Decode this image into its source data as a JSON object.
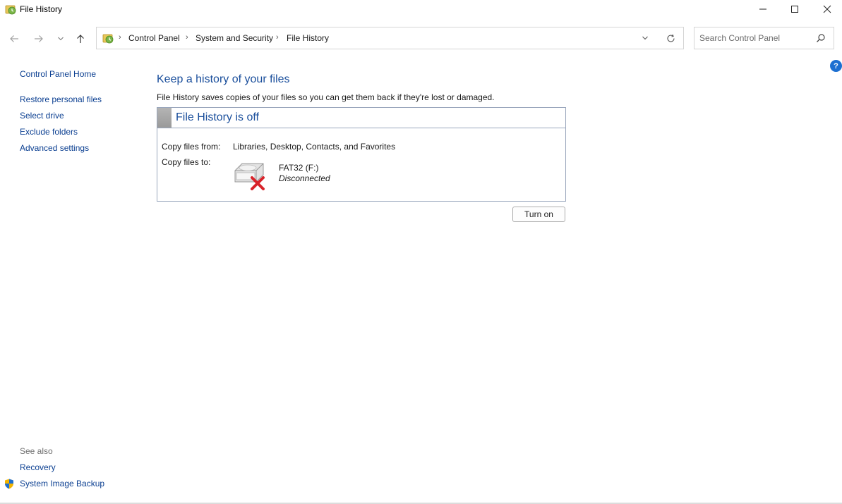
{
  "window": {
    "title": "File History",
    "icon": "file-history-icon"
  },
  "nav": {
    "back_icon": "arrow-left-icon",
    "forward_icon": "arrow-right-icon",
    "recent_icon": "chevron-down-icon",
    "up_icon": "arrow-up-icon",
    "breadcrumbs": [
      "Control Panel",
      "System and Security",
      "File History"
    ],
    "search_placeholder": "Search Control Panel"
  },
  "sidebar": {
    "home": "Control Panel Home",
    "tasks": [
      "Restore personal files",
      "Select drive",
      "Exclude folders",
      "Advanced settings"
    ],
    "see_also_label": "See also",
    "see_also": [
      "Recovery",
      "System Image Backup"
    ]
  },
  "main": {
    "heading": "Keep a history of your files",
    "description": "File History saves copies of your files so you can get them back if they're lost or damaged.",
    "status_title": "File History is off",
    "copy_from_label": "Copy files from:",
    "copy_from_value": "Libraries, Desktop, Contacts, and Favorites",
    "copy_to_label": "Copy files to:",
    "drive_name": "FAT32 (F:)",
    "drive_status": "Disconnected",
    "turn_on_label": "Turn on"
  },
  "colors": {
    "link": "#0b3f91",
    "heading": "#1b4f9c",
    "help": "#1d6fd1",
    "error_x": "#d8232a"
  }
}
